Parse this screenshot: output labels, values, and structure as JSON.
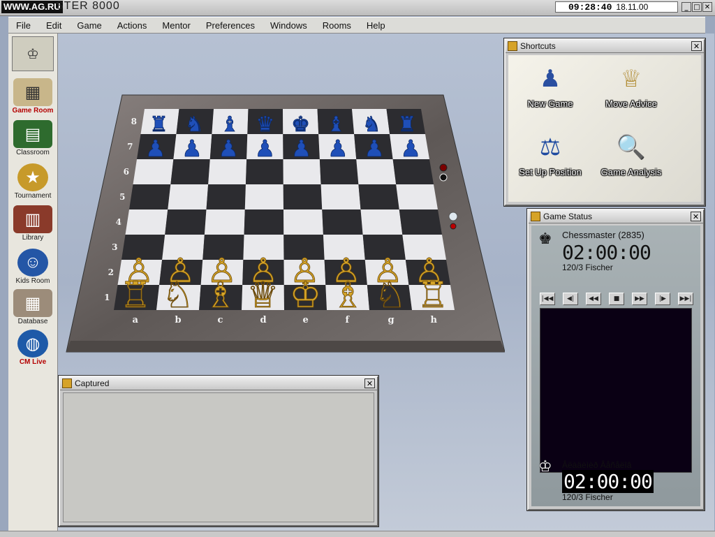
{
  "window": {
    "watermark": "WWW.AG.RU",
    "title": "STER 8000",
    "clock_time": "09:28:40",
    "clock_date": "18.11.00",
    "buttons": [
      "_",
      "□",
      "✕"
    ]
  },
  "menu": [
    {
      "label": "File"
    },
    {
      "label": "Edit"
    },
    {
      "label": "Game"
    },
    {
      "label": "Actions"
    },
    {
      "label": "Mentor"
    },
    {
      "label": "Preferences"
    },
    {
      "label": "Windows"
    },
    {
      "label": "Rooms"
    },
    {
      "label": "Help"
    }
  ],
  "sidebar": {
    "items": [
      {
        "label": "Game Room",
        "active": true,
        "icon": "chessboard-icon",
        "color": "#c8b68a"
      },
      {
        "label": "Classroom",
        "icon": "blackboard-icon",
        "color": "#2e6b2e"
      },
      {
        "label": "Tournament",
        "icon": "medal-icon",
        "color": "#c79a2a"
      },
      {
        "label": "Library",
        "icon": "books-icon",
        "color": "#8a3a2a"
      },
      {
        "label": "Kids Room",
        "icon": "kids-badge-icon",
        "color": "#2456a6"
      },
      {
        "label": "Database",
        "icon": "database-icon",
        "color": "#9c8c7a"
      },
      {
        "label": "CM Live",
        "icon": "globe-icon",
        "color": "#1e5aa8"
      }
    ]
  },
  "board": {
    "ranks": [
      "8",
      "7",
      "6",
      "5",
      "4",
      "3",
      "2",
      "1"
    ],
    "files": [
      "a",
      "b",
      "c",
      "d",
      "e",
      "f",
      "g",
      "h"
    ],
    "rows": [
      [
        "♜",
        "♞",
        "♝",
        "♛",
        "♚",
        "♝",
        "♞",
        "♜"
      ],
      [
        "♟",
        "♟",
        "♟",
        "♟",
        "♟",
        "♟",
        "♟",
        "♟"
      ],
      [
        "",
        "",
        "",
        "",
        "",
        "",
        "",
        ""
      ],
      [
        "",
        "",
        "",
        "",
        "",
        "",
        "",
        ""
      ],
      [
        "",
        "",
        "",
        "",
        "",
        "",
        "",
        ""
      ],
      [
        "",
        "",
        "",
        "",
        "",
        "",
        "",
        ""
      ],
      [
        "♙",
        "♙",
        "♙",
        "♙",
        "♙",
        "♙",
        "♙",
        "♙"
      ],
      [
        "♖",
        "♘",
        "♗",
        "♕",
        "♔",
        "♗",
        "♘",
        "♖"
      ]
    ],
    "colors": {
      "light": "#e9e9ec",
      "dark": "#2c2c30",
      "frame": "#6b6462",
      "black_pieces": "#1f4fb8",
      "white_pieces": "#d6a528"
    }
  },
  "shortcuts": {
    "title": "Shortcuts",
    "items": [
      {
        "label": "New Game",
        "icon": "new-game-icon"
      },
      {
        "label": "Move Advice",
        "icon": "move-advice-icon"
      },
      {
        "label": "Set Up Position",
        "icon": "setup-position-icon"
      },
      {
        "label": "Game Analysis",
        "icon": "game-analysis-icon"
      }
    ]
  },
  "game_status": {
    "title": "Game Status",
    "top_player": {
      "name": "Chessmaster   (2835)",
      "clock": "02:00:00",
      "time_control": "120/3  Fischer"
    },
    "bottom_player": {
      "name": "Âëàäèìèð Âåñåëîâ",
      "clock": "02:00:00",
      "time_control": "120/3  Fischer"
    },
    "nav_buttons": [
      "|◀◀",
      "◀|",
      "◀◀",
      "■",
      "▶▶",
      "|▶",
      "▶▶|"
    ]
  },
  "captured": {
    "title": "Captured"
  }
}
